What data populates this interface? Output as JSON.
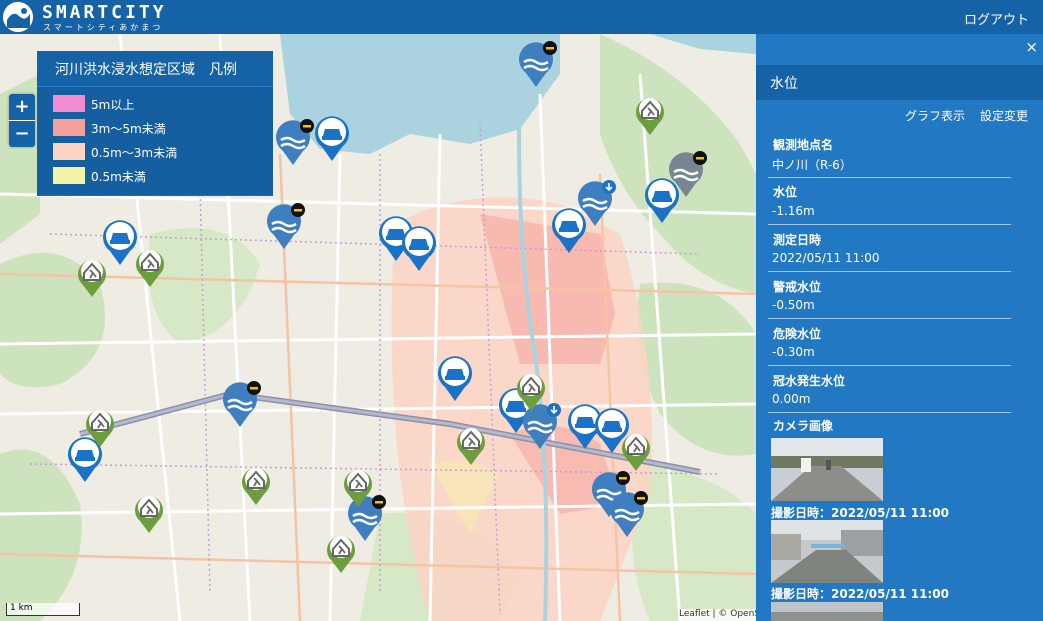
{
  "header": {
    "logo_title": "SMARTCITY",
    "logo_subtitle": "スマートシティあかまつ",
    "logout_label": "ログアウト"
  },
  "map": {
    "zoom_in_label": "+",
    "zoom_out_label": "−",
    "scale_label": "1 km",
    "attribution": "Leaflet | © OpenStreetMap",
    "legend": {
      "title": "河川洪水浸水想定区域　凡例",
      "items": [
        {
          "label": "5m以上",
          "color": "#f08ccf"
        },
        {
          "label": "3m〜5m未満",
          "color": "#f6a09c"
        },
        {
          "label": "0.5m〜3m未満",
          "color": "#fbd4c4"
        },
        {
          "label": "0.5m未満",
          "color": "#f4f2a8"
        }
      ]
    }
  },
  "panel": {
    "close_label": "×",
    "title": "水位",
    "graph_label": "グラフ表示",
    "settings_label": "設定変更",
    "fields": [
      {
        "label": "観測地点名",
        "value": "中ノ川（R-6）"
      },
      {
        "label": "水位",
        "value": "-1.16m"
      },
      {
        "label": "測定日時",
        "value": "2022/05/11 11:00"
      },
      {
        "label": "警戒水位",
        "value": "-0.50m"
      },
      {
        "label": "危険水位",
        "value": "-0.30m"
      },
      {
        "label": "冠水発生水位",
        "value": "0.00m"
      }
    ],
    "camera_label": "カメラ画像",
    "camera_captions": [
      "撮影日時：2022/05/11 11:00",
      "撮影日時：2022/05/11 11:00"
    ]
  },
  "colors": {
    "header": "#1563a6",
    "panel": "#2278c3",
    "marker_car": "#1a73c7",
    "marker_water": "#3f7fc0",
    "marker_shelter": "#6d9e3e"
  }
}
